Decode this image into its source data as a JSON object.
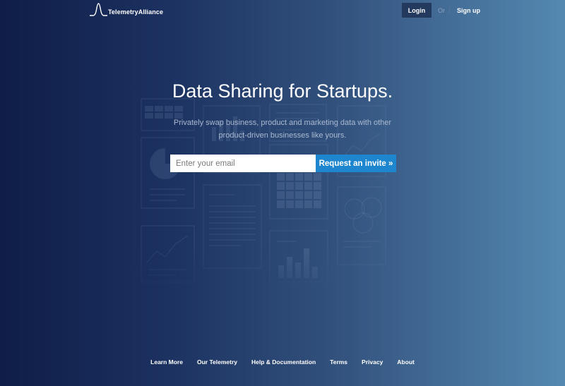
{
  "header": {
    "logo_text": "TelemetryAlliance",
    "login_label": "Login",
    "or_label": "Or",
    "signup_label": "Sign up"
  },
  "hero": {
    "title": "Data Sharing for Startups.",
    "subtitle": "Privately swap business, product and marketing data with other product-driven businesses like yours.",
    "email_placeholder": "Enter your email",
    "email_value": "",
    "invite_label": "Request an invite »"
  },
  "footer": {
    "links": [
      "Learn More",
      "Our Telemetry",
      "Help & Documentation",
      "Terms",
      "Privacy",
      "About"
    ]
  },
  "colors": {
    "background_left": "#0f1d47",
    "background_right": "#5489b1",
    "login_button": "#23395e",
    "invite_button": "#1e86cf"
  },
  "icons": {
    "logo": "spike-line-logo-icon",
    "background": "data-charts-illustration"
  }
}
